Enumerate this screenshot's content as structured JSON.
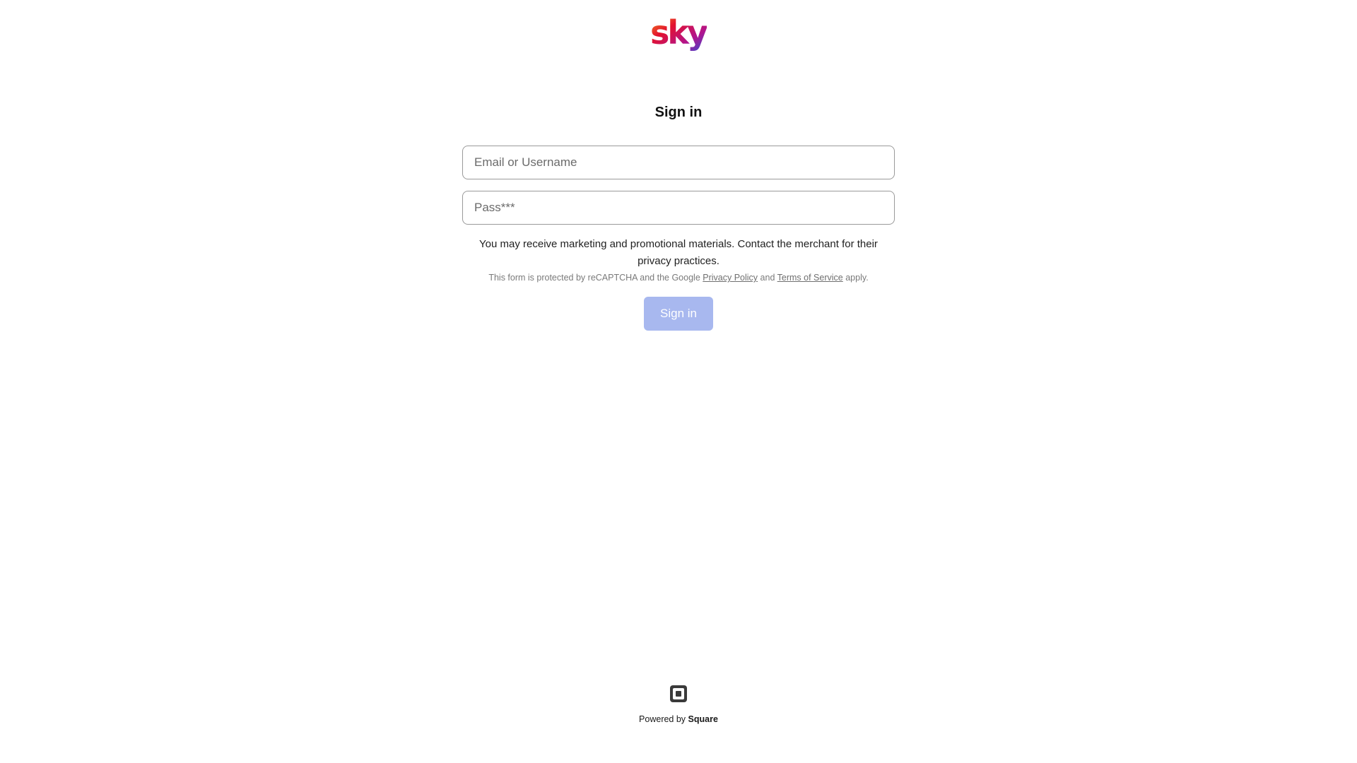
{
  "brand": {
    "logo_text": "sky",
    "logo_gradient": [
      "#f7a21b",
      "#e3122e",
      "#b0148f",
      "#2b4fd8"
    ]
  },
  "form": {
    "title": "Sign in",
    "email_placeholder": "Email or Username",
    "password_placeholder": "Pass***",
    "notice": "You may receive marketing and promotional materials. Contact the merchant for their privacy practices.",
    "recaptcha": {
      "prefix": "This form is protected by reCAPTCHA and the Google",
      "privacy_link": "Privacy Policy",
      "conjunction": "and",
      "terms_link": "Terms of Service",
      "suffix": "apply."
    },
    "submit_label": "Sign in",
    "submit_color": "#a8b8ef"
  },
  "footer": {
    "icon": "square-logo-icon",
    "powered_prefix": "Powered by",
    "powered_brand": "Square"
  }
}
